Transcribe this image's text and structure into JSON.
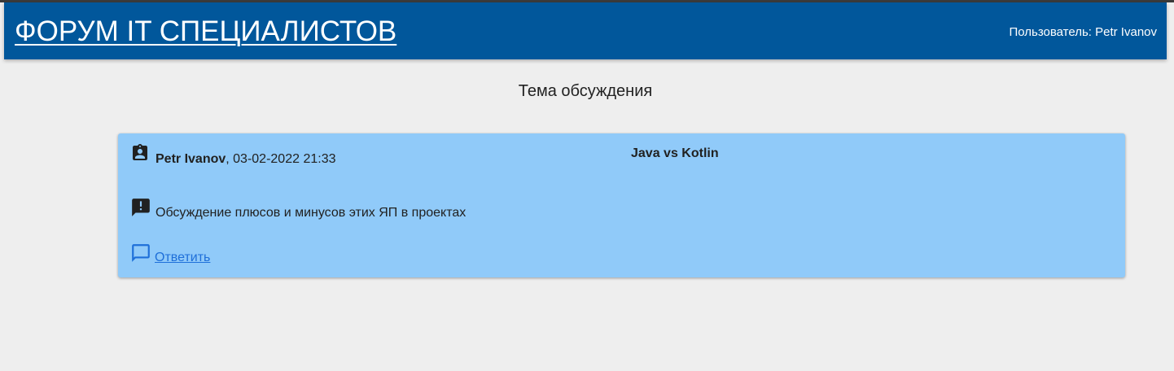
{
  "header": {
    "site_title": "ФОРУМ IT СПЕЦИАЛИСТОВ",
    "user_info": "Пользователь: Petr Ivanov"
  },
  "page": {
    "heading": "Тема обсуждения"
  },
  "topic": {
    "author": "Petr Ivanov",
    "date_suffix": ", 03-02-2022 21:33",
    "title": "Java vs Kotlin",
    "description": "Обсуждение плюсов и минусов этих ЯП в проектах",
    "reply_label": "Ответить"
  },
  "icons": {
    "author": "assignment-ind-icon",
    "description": "announcement-icon",
    "reply": "chat-bubble-outline-icon"
  },
  "colors": {
    "header_bg": "#01579b",
    "page_bg": "#eeeeee",
    "card_bg": "#90caf9",
    "link": "#1e6fd9"
  }
}
